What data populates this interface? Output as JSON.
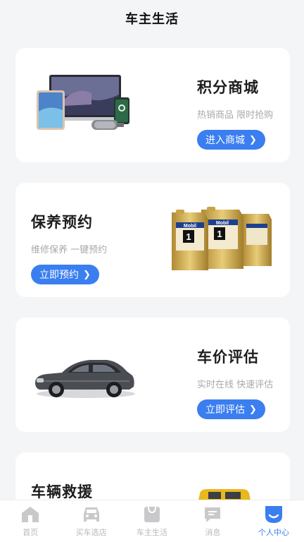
{
  "header": {
    "title": "车主生活"
  },
  "cards": [
    {
      "title": "积分商城",
      "subtitle": "热销商品 限时抢购",
      "button": "进入商城",
      "chevron": "❯"
    },
    {
      "title": "保养预约",
      "subtitle": "维修保养 一键预约",
      "button": "立即预约",
      "chevron": "❯"
    },
    {
      "title": "车价评估",
      "subtitle": "实时在线 快速评估",
      "button": "立即评估",
      "chevron": "❯"
    },
    {
      "title": "车辆救援"
    }
  ],
  "oil_brand": "Mobil",
  "tabs": [
    {
      "label": "首页",
      "icon": "home-icon"
    },
    {
      "label": "买车选店",
      "icon": "car-icon"
    },
    {
      "label": "车主生活",
      "icon": "shopping-bag-icon"
    },
    {
      "label": "消息",
      "icon": "message-icon"
    },
    {
      "label": "个人中心",
      "icon": "user-icon",
      "active": true
    }
  ],
  "colors": {
    "accent": "#3a7ef0",
    "inactive_tab": "#c9c9cc",
    "background": "#f4f5f7"
  }
}
